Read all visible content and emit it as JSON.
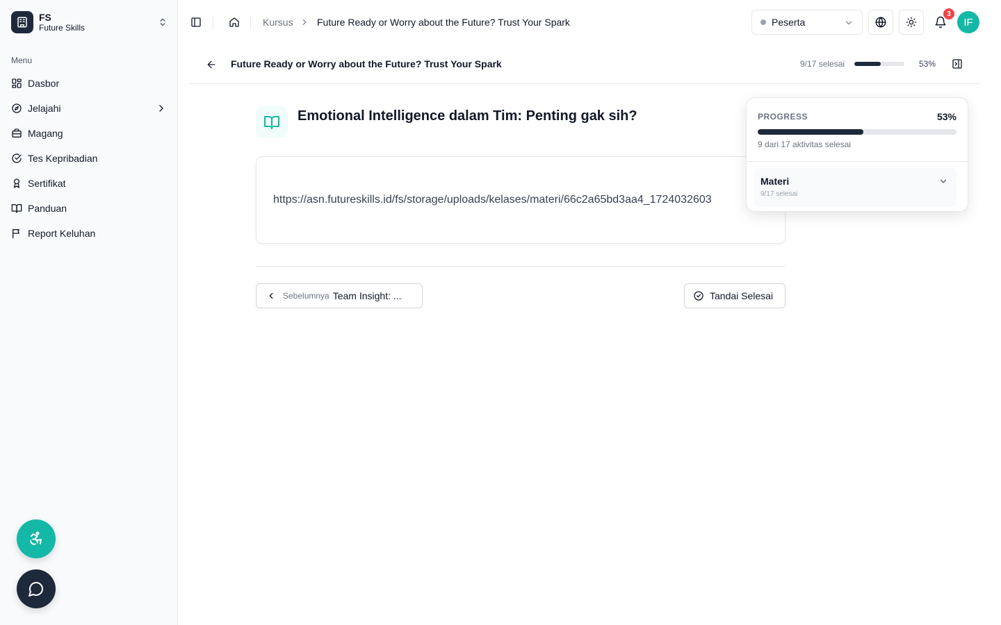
{
  "brand": {
    "abbr": "FS",
    "name": "Future Skills"
  },
  "sidebar": {
    "menu_label": "Menu",
    "items": [
      {
        "label": "Dasbor",
        "icon": "grid-icon"
      },
      {
        "label": "Jelajahi",
        "icon": "compass-icon"
      },
      {
        "label": "Magang",
        "icon": "briefcase-icon"
      },
      {
        "label": "Tes Kepribadian",
        "icon": "check-circle-icon"
      },
      {
        "label": "Sertifikat",
        "icon": "award-icon"
      },
      {
        "label": "Panduan",
        "icon": "book-open-icon"
      },
      {
        "label": "Report Keluhan",
        "icon": "flag-icon"
      }
    ]
  },
  "topbar": {
    "breadcrumb": {
      "parent": "Kursus",
      "current": "Future Ready or Worry about the Future? Trust Your Spark"
    },
    "role": "Peserta",
    "notification_count": "3",
    "avatar_initials": "IF"
  },
  "course": {
    "title": "Future Ready or Worry about the Future? Trust Your Spark",
    "completed_label": "9/17 selesai",
    "progress_percent": "53%",
    "progress_fraction": 0.53
  },
  "lesson": {
    "title": "Emotional Intelligence dalam Tim: Penting gak sih?",
    "link": "https://asn.futureskills.id/fs/storage/uploads/kelases/materi/66c2a65bd3aa4_1724032603",
    "prev_label": "Sebelumnya",
    "prev_title": "Team Insight: ...",
    "mark_done": "Tandai Selesai"
  },
  "progress_panel": {
    "label": "PROGRESS",
    "percent": "53%",
    "summary": "9 dari 17 aktivitas selesai",
    "section_title": "Materi",
    "section_sub": "9/17 selesai"
  },
  "colors": {
    "accent": "#14b8a6",
    "primary": "#1e293b",
    "badge": "#ef4444"
  }
}
